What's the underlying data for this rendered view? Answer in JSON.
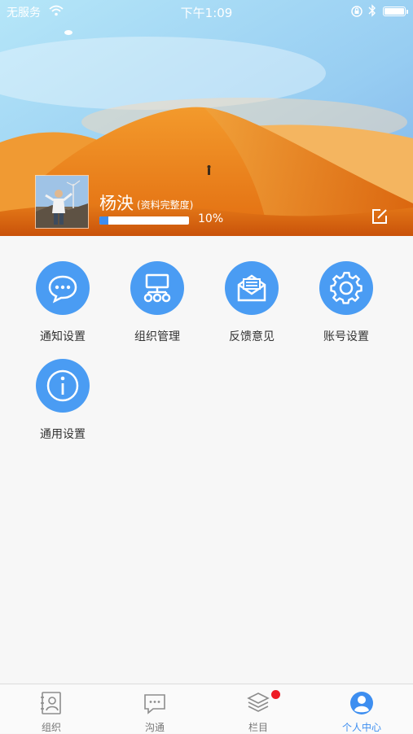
{
  "status_bar": {
    "carrier": "无服务",
    "time": "下午1:09"
  },
  "profile": {
    "name": "杨泱",
    "completion_label": "(资料完整度)",
    "completion_percent": 10,
    "completion_text": "10%"
  },
  "menu": {
    "items": [
      {
        "label": "通知设置",
        "icon": "chat-bubble-icon"
      },
      {
        "label": "组织管理",
        "icon": "org-chart-icon"
      },
      {
        "label": "反馈意见",
        "icon": "envelope-icon"
      },
      {
        "label": "账号设置",
        "icon": "gear-icon"
      },
      {
        "label": "通用设置",
        "icon": "info-icon"
      }
    ]
  },
  "tabbar": {
    "items": [
      {
        "label": "组织",
        "icon": "contacts-book-icon",
        "active": false
      },
      {
        "label": "沟通",
        "icon": "message-icon",
        "active": false
      },
      {
        "label": "栏目",
        "icon": "layers-icon",
        "active": false,
        "badge": true
      },
      {
        "label": "个人中心",
        "icon": "person-icon",
        "active": true
      }
    ]
  },
  "colors": {
    "accent": "#4a9cf3",
    "tab_active": "#3d8ef0",
    "badge": "#ee1c25"
  }
}
